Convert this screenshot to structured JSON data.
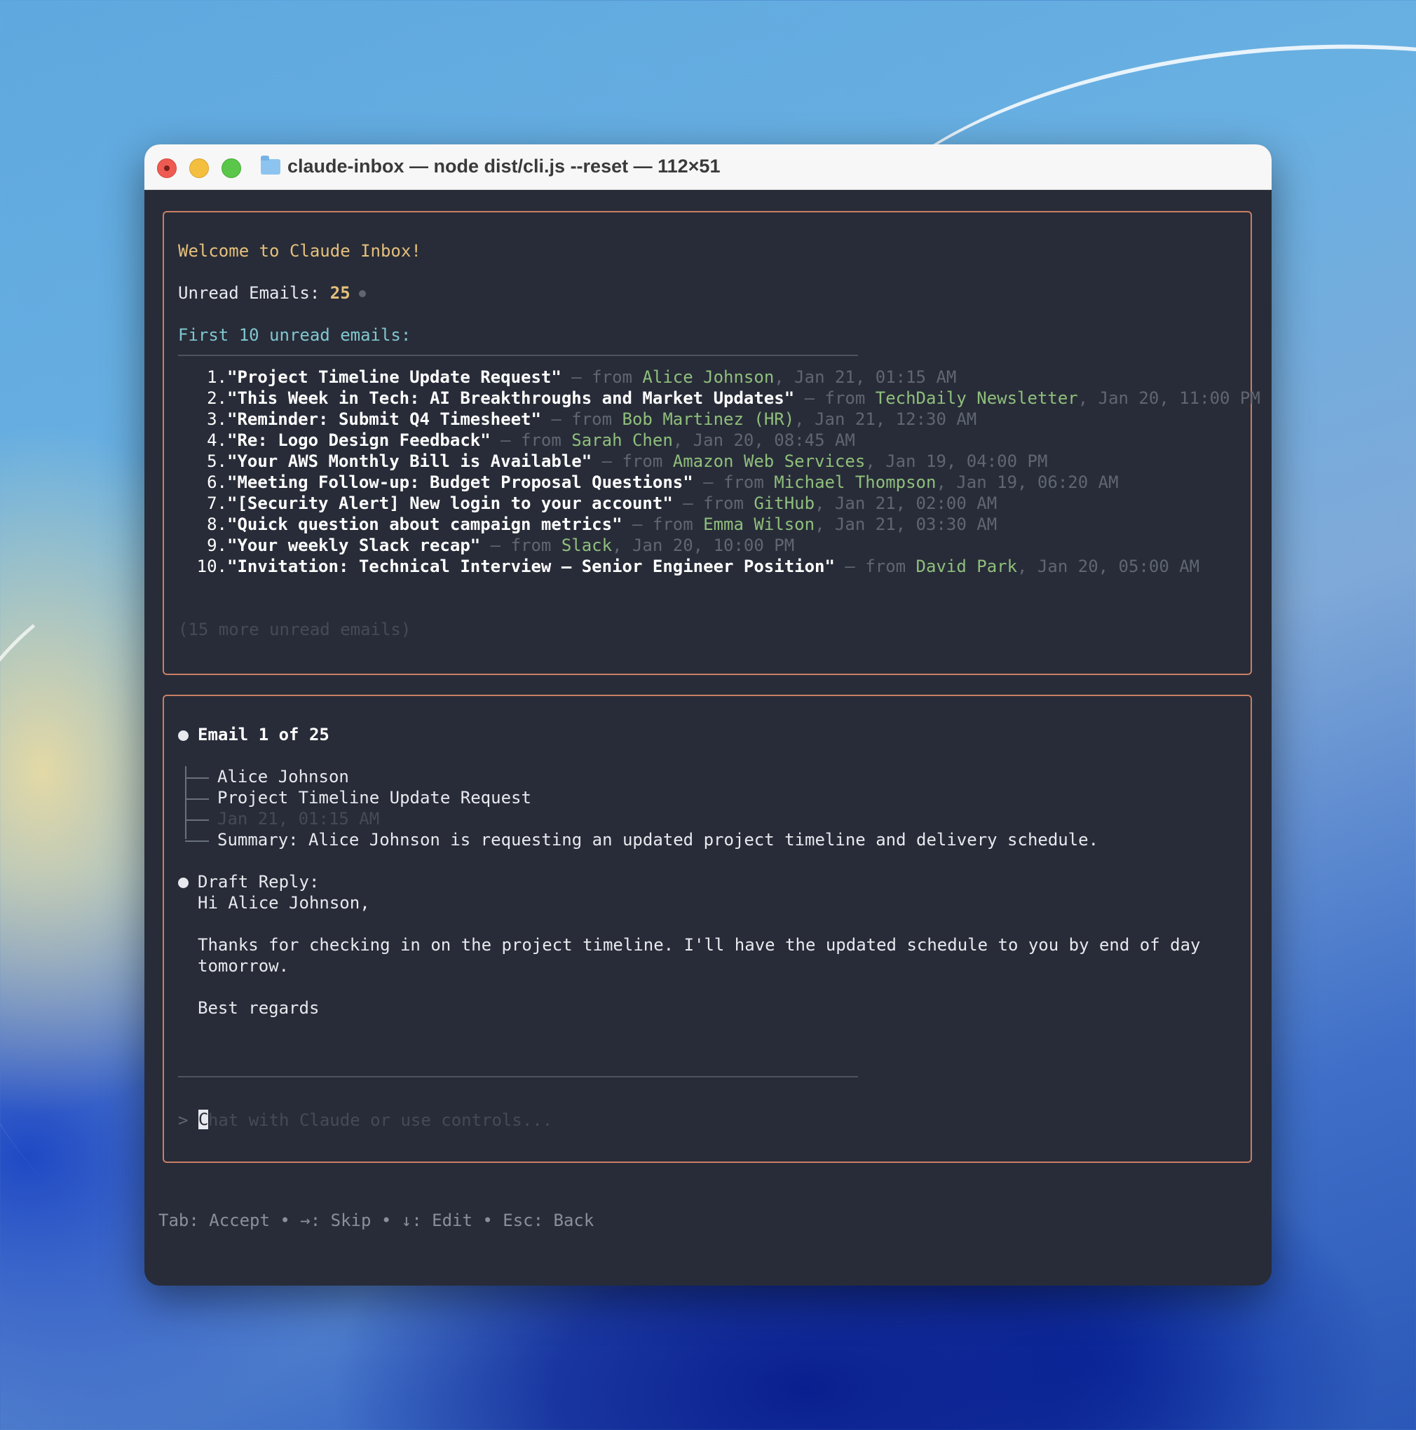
{
  "window": {
    "title": "claude-inbox — node dist/cli.js --reset — 112×51"
  },
  "welcome": {
    "greeting": "Welcome to Claude Inbox!",
    "unread_label": "Unread Emails: ",
    "unread_count": "25",
    "list_heading": "First 10 unread emails:",
    "more_text": "(15 more unread emails)"
  },
  "emails": [
    {
      "num": "1.",
      "subject": "\"Project Timeline Update Request\"",
      "from_label": " – from ",
      "sender": "Alice Johnson",
      "date": ", Jan 21, 01:15 AM"
    },
    {
      "num": "2.",
      "subject": "\"This Week in Tech: AI Breakthroughs and Market Updates\"",
      "from_label": " – from ",
      "sender": "TechDaily Newsletter",
      "date": ", Jan 20, 11:00 PM"
    },
    {
      "num": "3.",
      "subject": "\"Reminder: Submit Q4 Timesheet\"",
      "from_label": " – from ",
      "sender": "Bob Martinez (HR)",
      "date": ", Jan 21, 12:30 AM"
    },
    {
      "num": "4.",
      "subject": "\"Re: Logo Design Feedback\"",
      "from_label": " – from ",
      "sender": "Sarah Chen",
      "date": ", Jan 20, 08:45 AM"
    },
    {
      "num": "5.",
      "subject": "\"Your AWS Monthly Bill is Available\"",
      "from_label": " – from ",
      "sender": "Amazon Web Services",
      "date": ", Jan 19, 04:00 PM"
    },
    {
      "num": "6.",
      "subject": "\"Meeting Follow-up: Budget Proposal Questions\"",
      "from_label": " – from ",
      "sender": "Michael Thompson",
      "date": ", Jan 19, 06:20 AM"
    },
    {
      "num": "7.",
      "subject": "\"[Security Alert] New login to your account\"",
      "from_label": " – from ",
      "sender": "GitHub",
      "date": ", Jan 21, 02:00 AM"
    },
    {
      "num": "8.",
      "subject": "\"Quick question about campaign metrics\"",
      "from_label": " – from ",
      "sender": "Emma Wilson",
      "date": ", Jan 21, 03:30 AM"
    },
    {
      "num": "9.",
      "subject": "\"Your weekly Slack recap\"",
      "from_label": " – from ",
      "sender": "Slack",
      "date": ", Jan 20, 10:00 PM"
    },
    {
      "num": "10.",
      "subject": "\"Invitation: Technical Interview – Senior Engineer Position\"",
      "from_label": " – from ",
      "sender": "David Park",
      "date": ", Jan 20, 05:00 AM"
    }
  ],
  "detail": {
    "header": "Email 1 of 25",
    "sender": "Alice Johnson",
    "subject": "Project Timeline Update Request",
    "date": "Jan 21, 01:15 AM",
    "summary": "Summary: Alice Johnson is requesting an updated project timeline and delivery schedule.",
    "draft_label": "Draft Reply:",
    "draft_lines": [
      "Hi Alice Johnson,",
      "Thanks for checking in on the project timeline. I'll have the updated schedule to you by end of day",
      "tomorrow.",
      "Best regards"
    ]
  },
  "input": {
    "prompt": "> ",
    "cursor_char": "C",
    "placeholder_rest": "hat with Claude or use controls..."
  },
  "footer": {
    "help": "Tab: Accept • →: Skip • ↓: Edit • Esc: Back"
  },
  "colors": {
    "border": "#c97f65",
    "terminal_bg": "#282c38",
    "greeting": "#e5c07b",
    "heading": "#7fc7cf",
    "sender": "#8fbf7c"
  }
}
